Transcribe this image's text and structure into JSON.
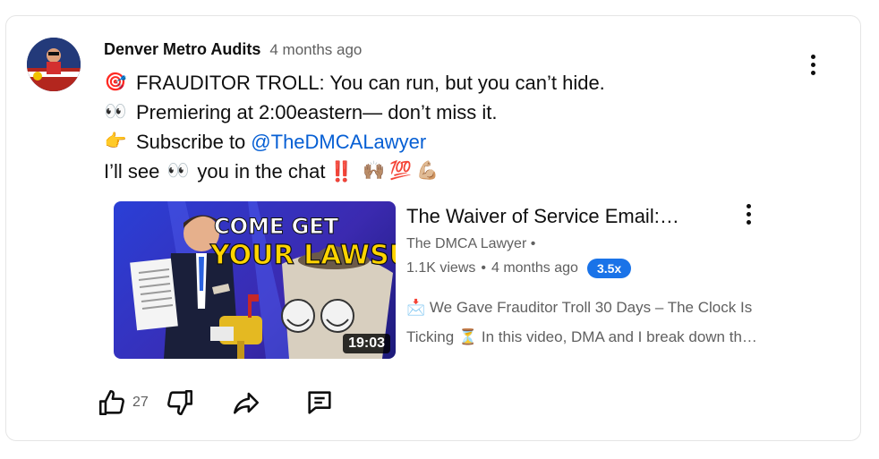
{
  "post": {
    "author": "Denver Metro Audits",
    "time": "4 months ago",
    "lines": [
      {
        "emoji": "🎯",
        "text": "FRAUDITOR TROLL: You can run, but you can’t hide."
      },
      {
        "emoji": "👀",
        "text": "Premiering at 2:00eastern— don’t miss it."
      },
      {
        "emoji": "👉",
        "text": "Subscribe to",
        "mention": "@TheDMCALawyer"
      }
    ],
    "last_line": {
      "a": "I’ll see",
      "eyes": "👀",
      "b": "you in the chat",
      "excl": "‼️",
      "emoji1": "🙌🏽",
      "emoji2": "💯",
      "emoji3": "💪🏼"
    }
  },
  "video": {
    "thumb_text1": "COME GET",
    "thumb_text2": "YOUR LAWSUIT",
    "duration": "19:03",
    "title": "The Waiver of Service Email:…",
    "channel": "The DMCA Lawyer",
    "channel_sep": "•",
    "views": "1.1K views",
    "meta_sep": "•",
    "age": "4 months ago",
    "speed": "3.5x",
    "desc_icon": "📩",
    "desc_line1": "We Gave Frauditor Troll 30 Days – The Clock Is",
    "desc_line2a": "Ticking",
    "desc_hourglass": "⏳",
    "desc_line2b": "In this video, DMA and I break down th…"
  },
  "actions": {
    "like_count": "27"
  },
  "icons": {
    "like": "thumbs-up-icon",
    "dislike": "thumbs-down-icon",
    "share": "share-icon",
    "comment": "comment-icon",
    "menu": "more-vertical-icon"
  },
  "colors": {
    "mention": "#065fd4",
    "speed_badge": "#1a73e8",
    "meta_text": "#606060"
  }
}
